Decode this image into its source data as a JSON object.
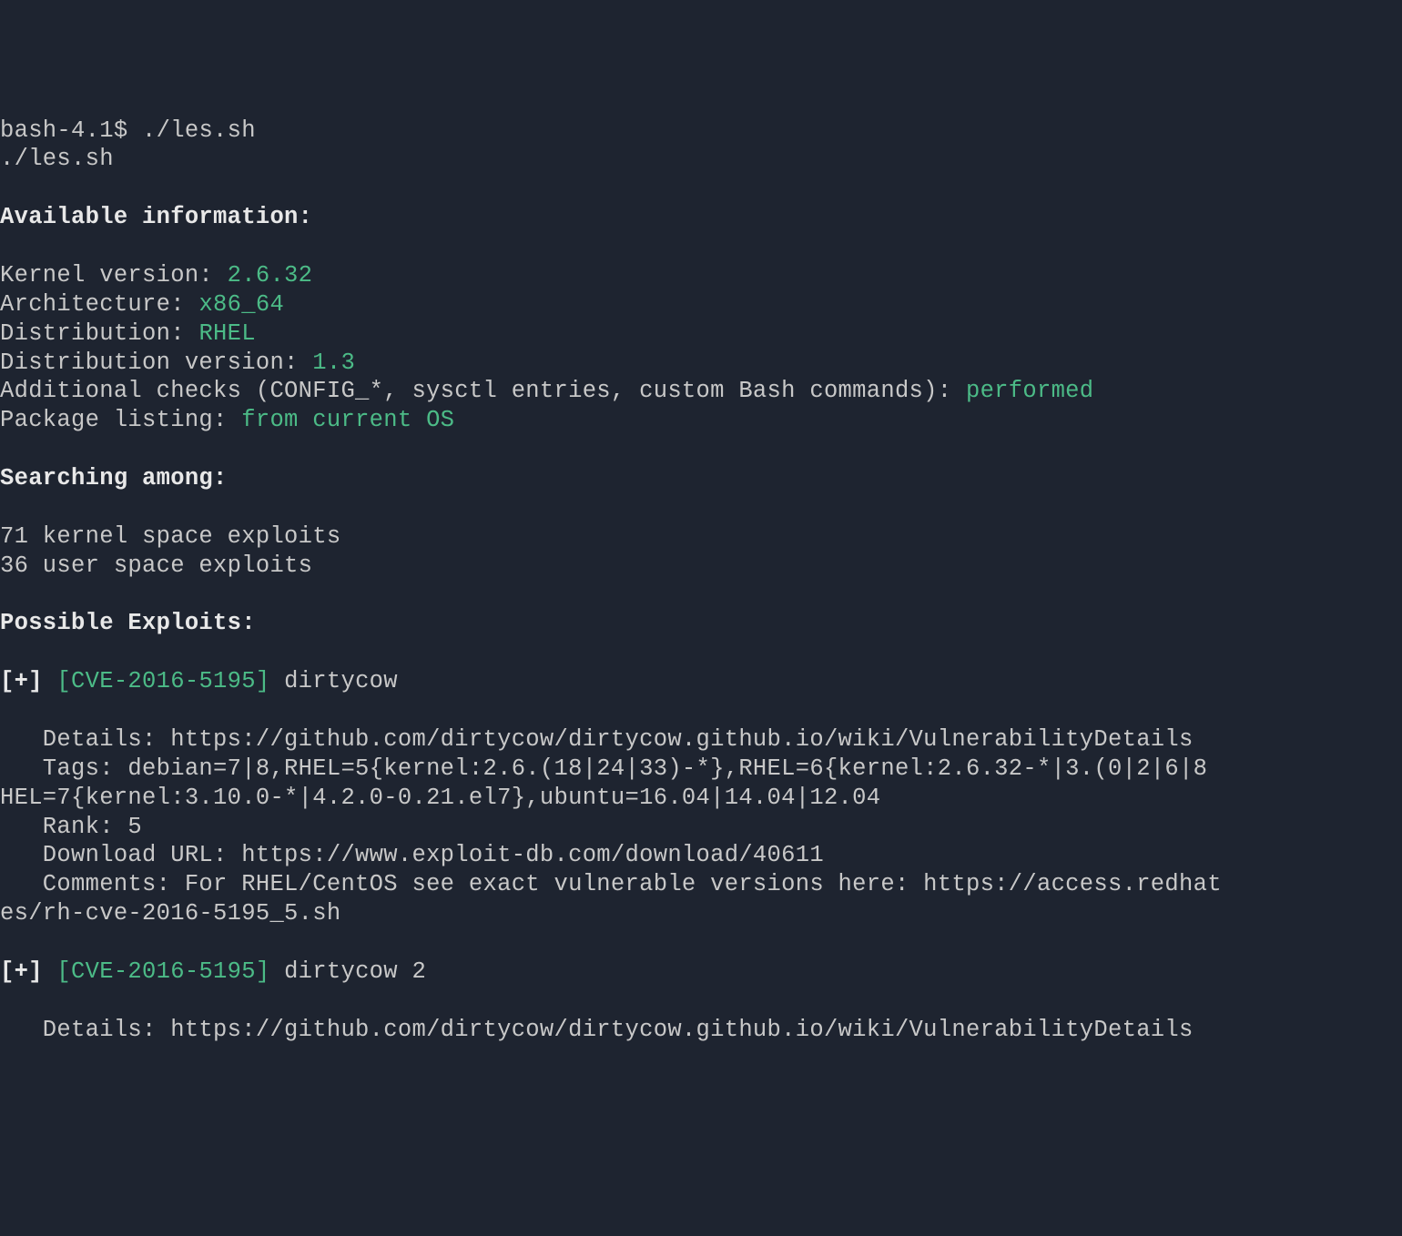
{
  "prompt": "bash-4.1$ ",
  "command": "./les.sh",
  "echo": "./les.sh",
  "available_header": "Available information:",
  "kernel_label": "Kernel version: ",
  "kernel_value": "2.6.32",
  "arch_label": "Architecture: ",
  "arch_value": "x86_64",
  "dist_label": "Distribution: ",
  "dist_value": "RHEL",
  "distver_label": "Distribution version: ",
  "distver_value": "1.3",
  "checks_label": "Additional checks (CONFIG_*, sysctl entries, custom Bash commands): ",
  "checks_value": "performed",
  "pkg_label": "Package listing: ",
  "pkg_value": "from current OS",
  "searching_header": "Searching among:",
  "kernel_exploits": "71 kernel space exploits",
  "user_exploits": "36 user space exploits",
  "possible_header": "Possible Exploits:",
  "exploit1_prefix": "[+] ",
  "exploit1_cve": "[CVE-2016-5195]",
  "exploit1_name": " dirtycow",
  "exploit1_details": "   Details: https://github.com/dirtycow/dirtycow.github.io/wiki/VulnerabilityDetails",
  "exploit1_tags1": "   Tags: debian=7|8,RHEL=5{kernel:2.6.(18|24|33)-*},RHEL=6{kernel:2.6.32-*|3.(0|2|6|8",
  "exploit1_tags2": "HEL=7{kernel:3.10.0-*|4.2.0-0.21.el7},ubuntu=16.04|14.04|12.04",
  "exploit1_rank": "   Rank: 5",
  "exploit1_url": "   Download URL: https://www.exploit-db.com/download/40611",
  "exploit1_comments1": "   Comments: For RHEL/CentOS see exact vulnerable versions here: https://access.redhat",
  "exploit1_comments2": "es/rh-cve-2016-5195_5.sh",
  "exploit2_prefix": "[+] ",
  "exploit2_cve": "[CVE-2016-5195]",
  "exploit2_name": " dirtycow 2",
  "exploit2_details": "   Details: https://github.com/dirtycow/dirtycow.github.io/wiki/VulnerabilityDetails"
}
